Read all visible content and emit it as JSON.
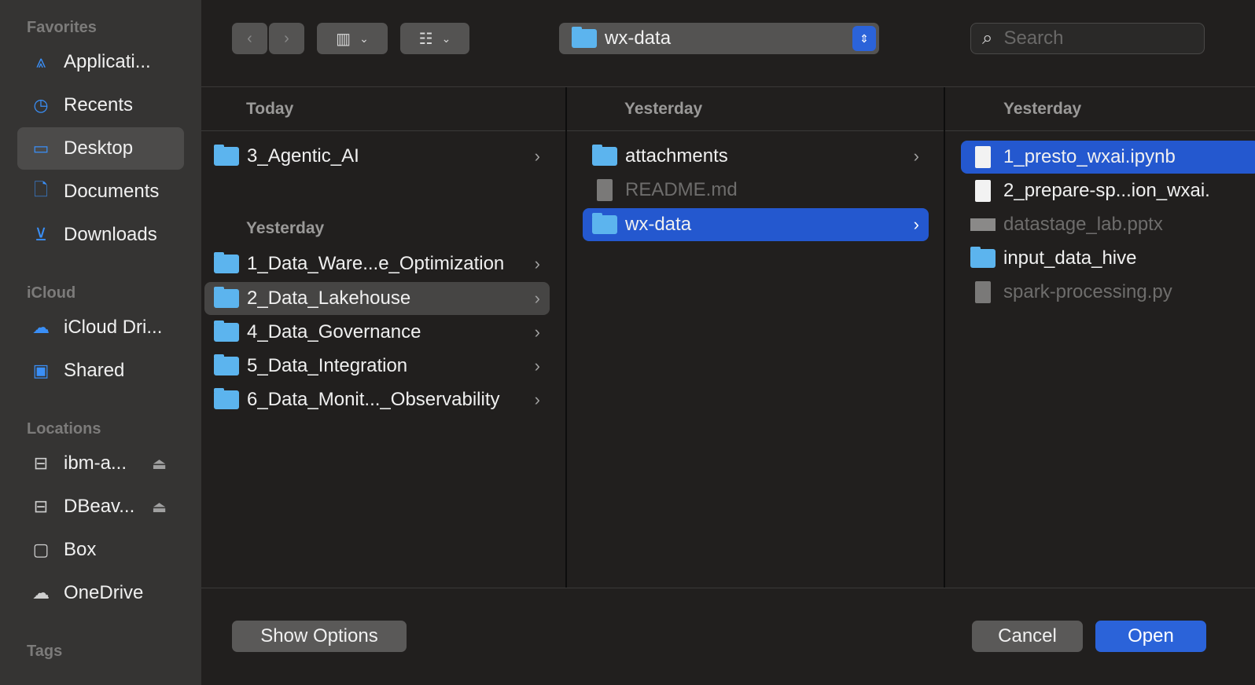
{
  "sidebar": {
    "favorites_label": "Favorites",
    "favorites": [
      {
        "label": "Applicati...",
        "icon": "app-store-icon"
      },
      {
        "label": "Recents",
        "icon": "clock-icon"
      },
      {
        "label": "Desktop",
        "icon": "desktop-icon",
        "selected": true
      },
      {
        "label": "Documents",
        "icon": "document-icon"
      },
      {
        "label": "Downloads",
        "icon": "download-icon"
      }
    ],
    "icloud_label": "iCloud",
    "icloud": [
      {
        "label": "iCloud Dri...",
        "icon": "cloud-icon"
      },
      {
        "label": "Shared",
        "icon": "shared-folder-icon"
      }
    ],
    "locations_label": "Locations",
    "locations": [
      {
        "label": "ibm-a...",
        "icon": "drive-icon"
      },
      {
        "label": "DBeav...",
        "icon": "drive-icon"
      },
      {
        "label": "Box",
        "icon": "box-icon"
      },
      {
        "label": "OneDrive",
        "icon": "cloud-icon"
      }
    ],
    "tags_label": "Tags"
  },
  "toolbar": {
    "path": "wx-data",
    "search_placeholder": "Search"
  },
  "columns": [
    {
      "groups": [
        {
          "header": "Today",
          "items": [
            {
              "name": "3_Agentic_AI",
              "type": "folder"
            }
          ]
        },
        {
          "header": "Yesterday",
          "items": [
            {
              "name": "1_Data_Ware...e_Optimization",
              "type": "folder"
            },
            {
              "name": "2_Data_Lakehouse",
              "type": "folder",
              "highlighted": true
            },
            {
              "name": "4_Data_Governance",
              "type": "folder"
            },
            {
              "name": "5_Data_Integration",
              "type": "folder"
            },
            {
              "name": "6_Data_Monit..._Observability",
              "type": "folder"
            }
          ]
        }
      ]
    },
    {
      "groups": [
        {
          "header": "Yesterday",
          "items": [
            {
              "name": "attachments",
              "type": "folder"
            },
            {
              "name": "README.md",
              "type": "file",
              "disabled": true
            },
            {
              "name": "wx-data",
              "type": "folder",
              "selected": true
            }
          ]
        }
      ]
    },
    {
      "groups": [
        {
          "header": "Yesterday",
          "items": [
            {
              "name": "1_presto_wxai.ipynb",
              "type": "file",
              "selected": true
            },
            {
              "name": "2_prepare-sp...ion_wxai.",
              "type": "file"
            },
            {
              "name": "datastage_lab.pptx",
              "type": "file",
              "disabled": true
            },
            {
              "name": "input_data_hive",
              "type": "folder"
            },
            {
              "name": "spark-processing.py",
              "type": "file",
              "disabled": true
            }
          ]
        }
      ]
    }
  ],
  "footer": {
    "show_options": "Show Options",
    "cancel": "Cancel",
    "open": "Open"
  },
  "colors": {
    "accent": "#2458cf",
    "sidebar": "#353433",
    "background": "#211f1e"
  }
}
